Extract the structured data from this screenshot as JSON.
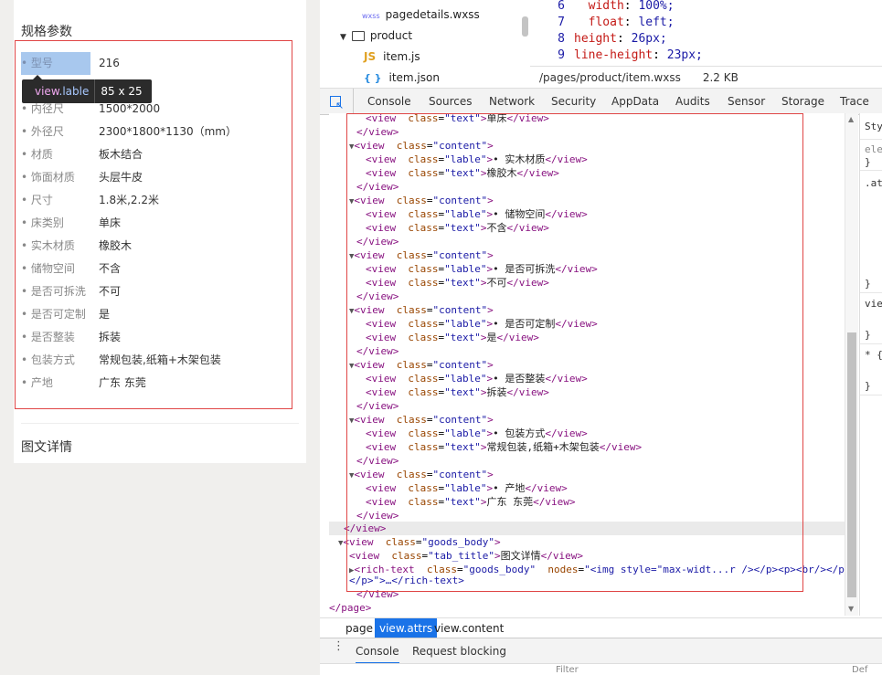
{
  "preview": {
    "spec_title": "规格参数",
    "detail_title": "图文详情",
    "rows": [
      {
        "label": "• 型号",
        "text": "216"
      },
      {
        "label": "",
        "text": ""
      },
      {
        "label": "• 内径尺",
        "text": "1500*2000"
      },
      {
        "label": "• 外径尺",
        "text": "2300*1800*1130（mm）"
      },
      {
        "label": "• 材质",
        "text": "板木结合"
      },
      {
        "label": "• 饰面材质",
        "text": "头层牛皮"
      },
      {
        "label": "• 尺寸",
        "text": "1.8米,2.2米"
      },
      {
        "label": "• 床类别",
        "text": "单床"
      },
      {
        "label": "• 实木材质",
        "text": "橡胶木"
      },
      {
        "label": "• 储物空间",
        "text": "不含"
      },
      {
        "label": "• 是否可拆洗",
        "text": "不可"
      },
      {
        "label": "• 是否可定制",
        "text": "是"
      },
      {
        "label": "• 是否整装",
        "text": "拆装"
      },
      {
        "label": "• 包装方式",
        "text": "常规包装,纸箱+木架包装"
      },
      {
        "label": "• 产地",
        "text": "广东 东莞"
      }
    ],
    "tooltip": {
      "tag": "view",
      "cls": ".lable",
      "size": "85 x 25"
    }
  },
  "files": [
    {
      "icon": "wxss",
      "name": "pagedetails.wxss"
    },
    {
      "icon": "folder",
      "name": "product"
    },
    {
      "icon": "js",
      "name": "item.js"
    },
    {
      "icon": "json",
      "name": "item.json"
    }
  ],
  "code": [
    {
      "ln": "6",
      "prop": "width",
      "val": "100%;"
    },
    {
      "ln": "7",
      "prop": "float",
      "val": "left;"
    },
    {
      "ln": "8",
      "prop": "height",
      "val": "26px;"
    },
    {
      "ln": "9",
      "prop": "line-height",
      "val": "23px;"
    }
  ],
  "file_path": "/pages/product/item.wxss",
  "file_size": "2.2 KB",
  "tabs": [
    "Console",
    "Sources",
    "Network",
    "Security",
    "AppData",
    "Audits",
    "Sensor",
    "Storage",
    "Trace"
  ],
  "elements": {
    "tail_text": "单床",
    "items": [
      {
        "label": "• 实木材质",
        "text": "橡胶木"
      },
      {
        "label": "• 储物空间",
        "text": "不含"
      },
      {
        "label": "• 是否可拆洗",
        "text": "不可"
      },
      {
        "label": "• 是否可定制",
        "text": "是"
      },
      {
        "label": "• 是否整装",
        "text": "拆装"
      },
      {
        "label": "• 包装方式",
        "text": "常规包装,纸箱+木架包装"
      },
      {
        "label": "• 产地",
        "text": "广东 东莞"
      }
    ],
    "goods_body_class": "goods_body",
    "tab_title_class": "tab_title",
    "tab_title_text": "图文详情",
    "rich_text_nodes": "<img style=\"max-widt...r /></p><p><br/></p>\"",
    "rich_text_nodes_wrap": "</p>\">…</rich-text>"
  },
  "styles_panel": [
    "Sty",
    "ele",
    "}",
    ".at",
    "}",
    "vie",
    "}",
    "* {",
    "}"
  ],
  "breadcrumb": [
    "page",
    "view.attrs",
    "view.content"
  ],
  "drawer_tabs": [
    "Console",
    "Request blocking"
  ],
  "console_filter": "Filter",
  "console_default": "Def"
}
